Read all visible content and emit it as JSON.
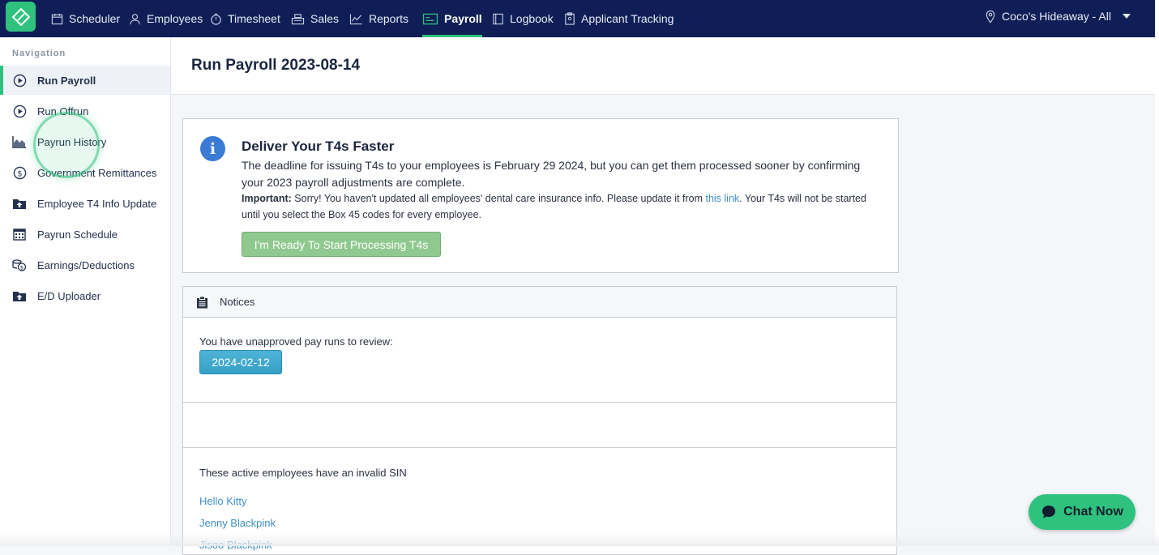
{
  "topnav": {
    "items": [
      {
        "label": "Scheduler",
        "icon": "calendar-icon"
      },
      {
        "label": "Employees",
        "icon": "person-icon"
      },
      {
        "label": "Timesheet",
        "icon": "stopwatch-icon"
      },
      {
        "label": "Sales",
        "icon": "register-icon"
      },
      {
        "label": "Reports",
        "icon": "line-chart-icon"
      },
      {
        "label": "Payroll",
        "icon": "payroll-icon",
        "active": true
      },
      {
        "label": "Logbook",
        "icon": "book-icon"
      },
      {
        "label": "Applicant Tracking",
        "icon": "clipboard-icon"
      }
    ],
    "location": "Coco's Hideaway - All"
  },
  "sidebar": {
    "heading": "Navigation",
    "items": [
      {
        "label": "Run Payroll",
        "icon": "play-circle-icon",
        "active": true
      },
      {
        "label": "Run Offrun",
        "icon": "play-circle-icon"
      },
      {
        "label": "Payrun History",
        "icon": "area-chart-icon"
      },
      {
        "label": "Government Remittances",
        "icon": "dollar-circle-icon"
      },
      {
        "label": "Employee T4 Info Update",
        "icon": "upload-folder-icon"
      },
      {
        "label": "Payrun Schedule",
        "icon": "calendar-grid-icon"
      },
      {
        "label": "Earnings/Deductions",
        "icon": "coins-icon"
      },
      {
        "label": "E/D Uploader",
        "icon": "upload-folder-icon"
      }
    ]
  },
  "page": {
    "title": "Run Payroll 2023-08-14"
  },
  "t4_notice": {
    "title": "Deliver Your T4s Faster",
    "body": "The deadline for issuing T4s to your employees is February 29 2024, but you can get them processed sooner by confirming your 2023 payroll adjustments are complete.",
    "important_label": "Important:",
    "important_text_1": " Sorry! You haven't updated all employees' dental care insurance info. Please update it from ",
    "link_text": "this link",
    "important_text_2": ". Your T4s will not be started until you select the Box 45 codes for every employee.",
    "button_label": "I'm Ready To Start Processing T4s"
  },
  "notices": {
    "title": "Notices",
    "unapproved_text": "You have unapproved pay runs to review:",
    "unapproved_run": "2024-02-12",
    "invalid_sin_text": "These active employees have an invalid SIN",
    "employees": [
      "Hello Kitty",
      "Jenny Blackpink",
      "Jisoo Blackpink"
    ]
  },
  "chat": {
    "label": "Chat Now"
  },
  "colors": {
    "topbar": "#0f1e56",
    "accent": "#2ec27e",
    "link": "#3d8fc8"
  }
}
